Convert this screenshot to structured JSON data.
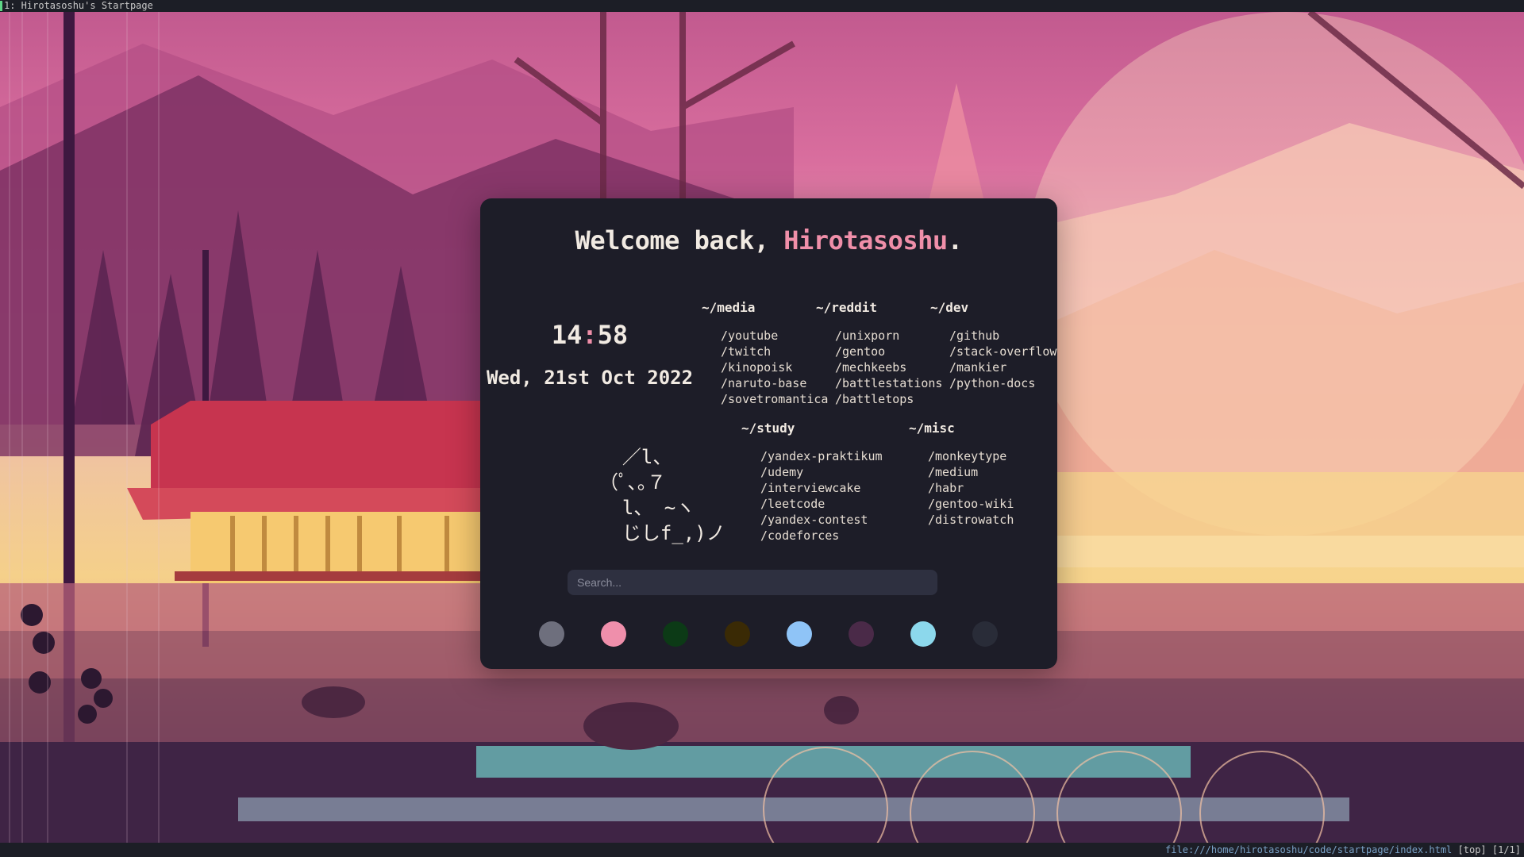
{
  "topbar": {
    "title": "1: Hirotasoshu's Startpage"
  },
  "statusbar": {
    "url": "file:///home/hirotasoshu/code/startpage/index.html",
    "position": "[top] [1/1]"
  },
  "welcome": {
    "prefix": "Welcome back, ",
    "name": "Hirotasoshu",
    "suffix": "."
  },
  "clock": {
    "hours": "14",
    "colon": ":",
    "minutes": "58"
  },
  "date": "Wed, 21st Oct 2022",
  "ascii_art": "  ／l、\n（ﾟ､｡７\n  l、 ~ヽ\n  じしf_,)ノ",
  "groups": [
    {
      "title": "~/media",
      "links": [
        "/youtube",
        "/twitch",
        "/kinopoisk",
        "/naruto-base",
        "/sovetromantica"
      ]
    },
    {
      "title": "~/reddit",
      "links": [
        "/unixporn",
        "/gentoo",
        "/mechkeebs",
        "/battlestations",
        "/battletops"
      ]
    },
    {
      "title": "~/dev",
      "links": [
        "/github",
        "/stack-overflow",
        "/mankier",
        "/python-docs"
      ]
    },
    {
      "title": "~/study",
      "links": [
        "/yandex-praktikum",
        "/udemy",
        "/interviewcake",
        "/leetcode",
        "/yandex-contest",
        "/codeforces"
      ]
    },
    {
      "title": "~/misc",
      "links": [
        "/monkeytype",
        "/medium",
        "/habr",
        "/gentoo-wiki",
        "/distrowatch"
      ]
    }
  ],
  "search": {
    "placeholder": "Search..."
  },
  "palette": [
    "#6e6f7d",
    "#ef8fab",
    "#0c3a16",
    "#3a2a05",
    "#8fc4f7",
    "#4a2a48",
    "#8cd8ec",
    "#292c38"
  ]
}
